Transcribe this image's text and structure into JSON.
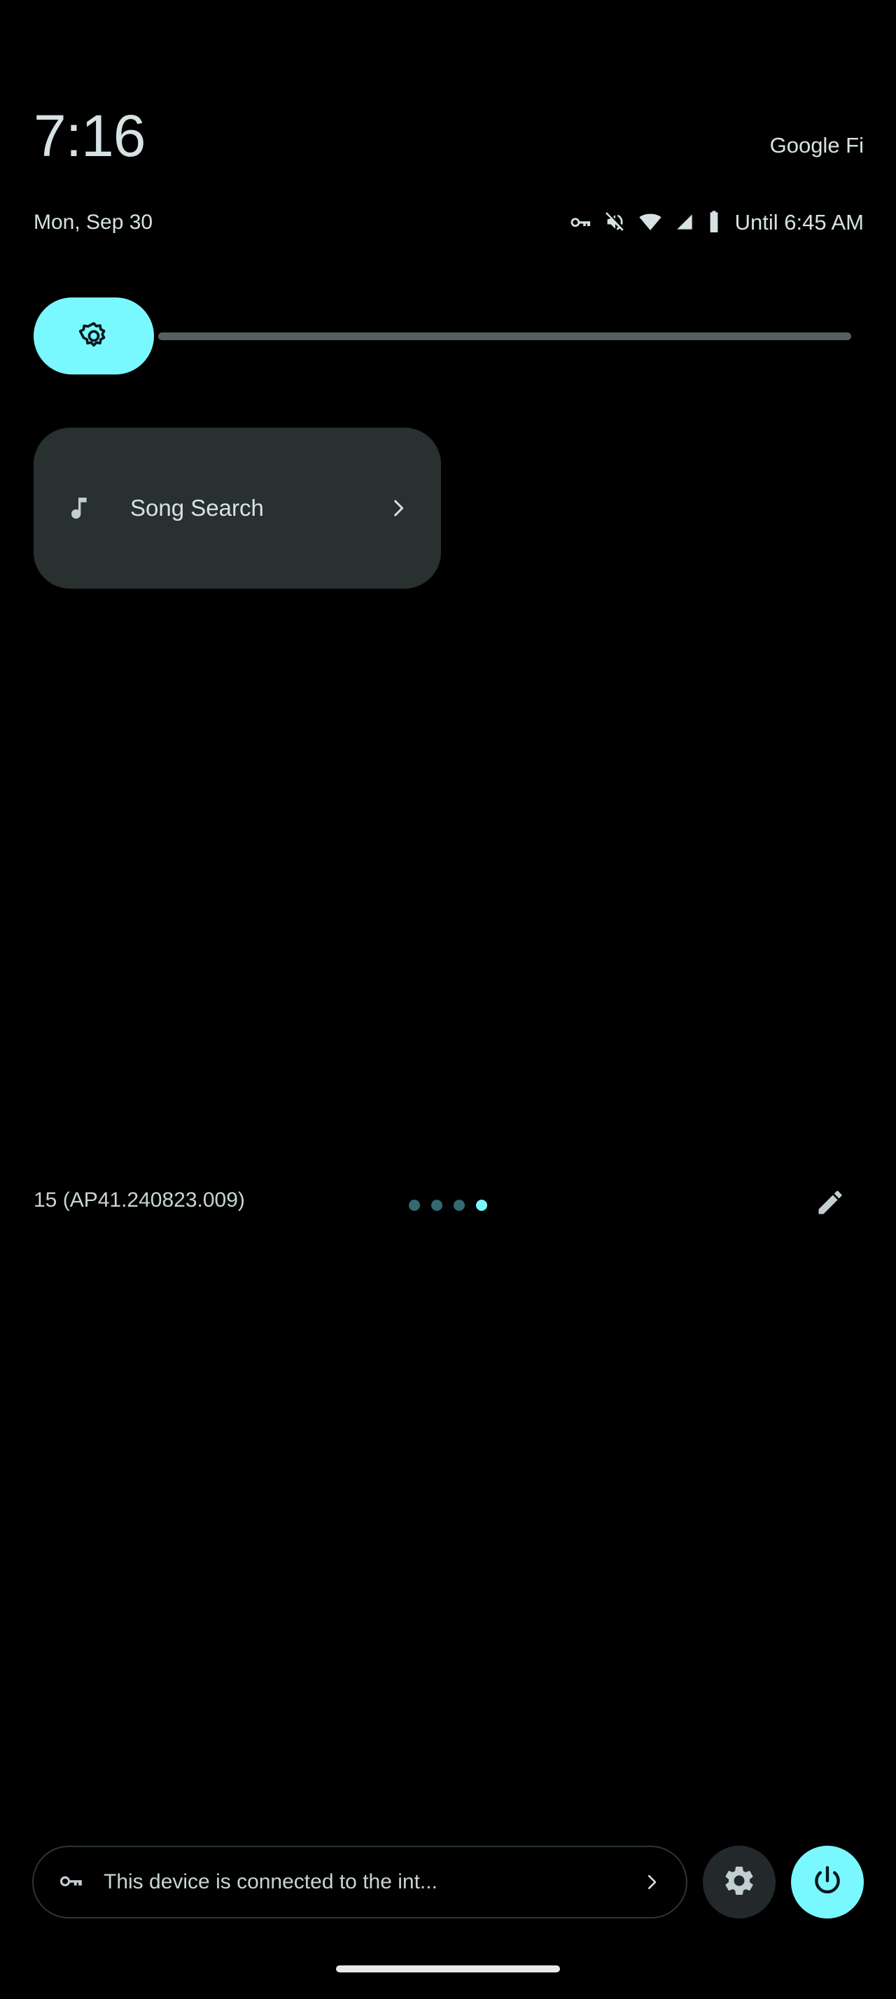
{
  "theme": {
    "background": "#000000",
    "accent": "#7af8ff",
    "text_primary": "#d6e2e3",
    "text_secondary": "#c9d4d5",
    "tile_background": "#283030",
    "slider_track": "#566063",
    "dot_inactive": "#336a70",
    "settings_button_background": "#23292a",
    "chip_border": "#2a3636"
  },
  "status_bar": {
    "clock": "7:16",
    "carrier": "Google Fi",
    "date": "Mon, Sep 30",
    "dnd_until": "Until 6:45 AM",
    "icons": [
      {
        "name": "vpn-key-icon",
        "label": "VPN"
      },
      {
        "name": "volume-off-icon",
        "label": "Muted"
      },
      {
        "name": "wifi-icon",
        "label": "Wi-Fi"
      },
      {
        "name": "cellular-signal-icon",
        "label": "Signal"
      },
      {
        "name": "battery-icon",
        "label": "Battery"
      }
    ]
  },
  "brightness": {
    "icon": "brightness-icon",
    "value_percent": 15,
    "min": 0,
    "max": 100
  },
  "tiles": [
    {
      "id": "song-search",
      "label": "Song Search",
      "icon": "music-note-icon",
      "chevron": "chevron-right-icon",
      "state": "off"
    }
  ],
  "pager": {
    "build_version": "15 (AP41.240823.009)",
    "page_count": 4,
    "active_page": 4,
    "edit_icon": "edit-pencil-icon"
  },
  "bottom_bar": {
    "vpn_chip": {
      "icon": "vpn-key-icon",
      "text": "This device is connected to the int...",
      "chevron": "chevron-right-icon"
    },
    "settings_button": {
      "icon": "gear-icon",
      "label": "Settings"
    },
    "power_button": {
      "icon": "power-icon",
      "label": "Power"
    }
  },
  "navigation": {
    "home_indicator": true
  }
}
